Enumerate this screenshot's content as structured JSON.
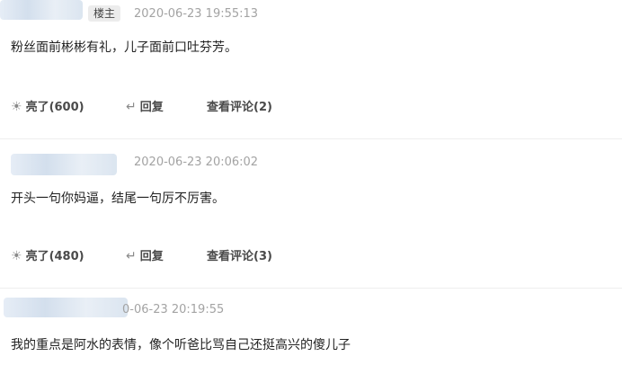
{
  "comments": [
    {
      "badge": "楼主",
      "time": "2020-06-23 19:55:13",
      "content": "粉丝面前彬彬有礼，儿子面前口吐芬芳。",
      "like_label": "亮了(600)",
      "reply_label": "回复",
      "view_label": "查看评论(2)"
    },
    {
      "time": "2020-06-23 20:06:02",
      "content": "开头一句你妈逼，结尾一句厉不厉害。",
      "like_label": "亮了(480)",
      "reply_label": "回复",
      "view_label": "查看评论(3)"
    },
    {
      "time": "0-06-23 20:19:55",
      "content": "我的重点是阿水的表情，像个听爸比骂自己还挺高兴的傻儿子"
    }
  ],
  "icons": {
    "like": "lightbulb-icon",
    "reply": "reply-arrow-icon"
  }
}
